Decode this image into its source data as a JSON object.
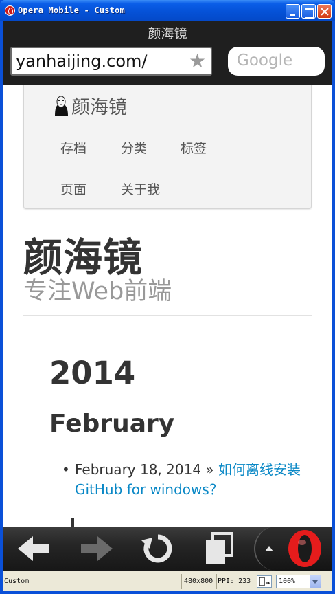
{
  "window": {
    "title": "Opera Mobile - Custom",
    "colors": {
      "titlebar": "#0552d8",
      "close_button": "#d23a12"
    }
  },
  "browser": {
    "page_title": "颜海镜",
    "address": "yanhaijing.com/",
    "bookmark_icon": "star-icon",
    "search_placeholder": "Google"
  },
  "site": {
    "brand": "颜海镜",
    "avatar_icon": "no-face-avatar",
    "nav": [
      "存档",
      "分类",
      "标签",
      "页面",
      "关于我"
    ],
    "title": "颜海镜",
    "subtitle": "专注Web前端"
  },
  "archive": {
    "year": "2014",
    "month": "February",
    "posts": [
      {
        "date": "February 18, 2014",
        "separator": " » ",
        "title_line1": "如何离线安装",
        "title_line2": "GitHub for windows？"
      }
    ],
    "link_color": "#0a88c6"
  },
  "toolbar": {
    "icons": [
      "back-arrow-icon",
      "forward-arrow-icon",
      "reload-icon",
      "tabs-icon",
      "menu-up-icon",
      "opera-logo-icon"
    ]
  },
  "statusbar": {
    "profile": "Custom",
    "resolution": "480x800",
    "ppi": "PPI: 233",
    "zoom": "100%"
  }
}
